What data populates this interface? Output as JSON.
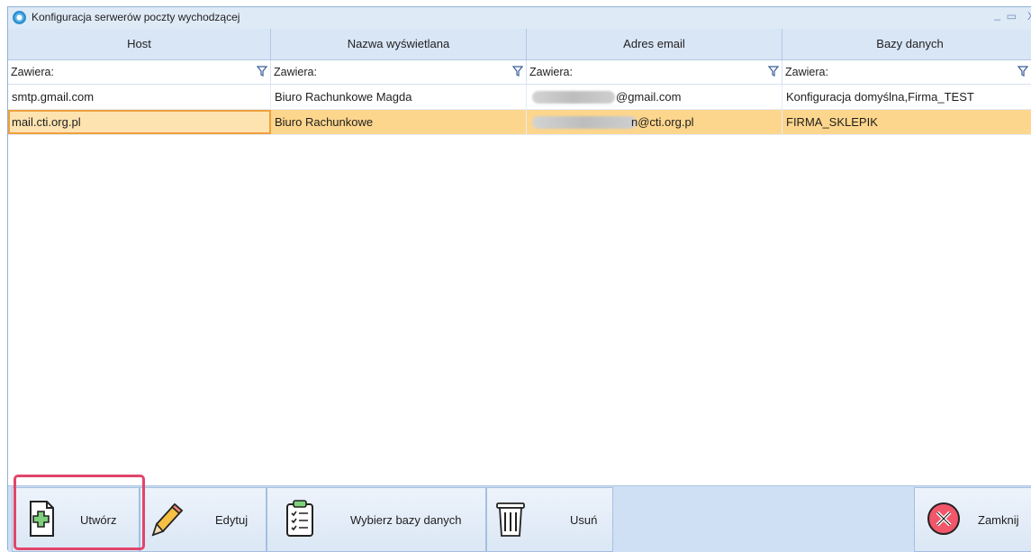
{
  "window": {
    "title": "Konfiguracja serwerów poczty wychodzącej",
    "min_glyph": "_",
    "max_glyph": "▭",
    "close_glyph": "X"
  },
  "grid": {
    "columns": [
      "Host",
      "Nazwa wyświetlana",
      "Adres email",
      "Bazy danych"
    ],
    "filter_label": "Zawiera:",
    "rows": [
      {
        "host": "smtp.gmail.com",
        "name": "Biuro Rachunkowe Magda",
        "email": "@gmail.com",
        "db": "Konfiguracja domyślna,Firma_TEST",
        "selected": false
      },
      {
        "host": "mail.cti.org.pl",
        "name": "Biuro Rachunkowe",
        "email": "n@cti.org.pl",
        "db": "FIRMA_SKLEPIK",
        "selected": true
      }
    ]
  },
  "toolbar": {
    "create": "Utwórz",
    "edit": "Edytuj",
    "choose_db": "Wybierz bazy danych",
    "delete": "Usuń",
    "close": "Zamknij"
  },
  "icons": [
    "app-icon",
    "filter-icon",
    "add-document-icon",
    "pencil-icon",
    "clipboard-list-icon",
    "trash-icon",
    "close-circle-icon"
  ],
  "colors": {
    "selected_row": "#fdd68d",
    "header_bg": "#d9e6f6",
    "highlight_frame": "#e2456b"
  }
}
